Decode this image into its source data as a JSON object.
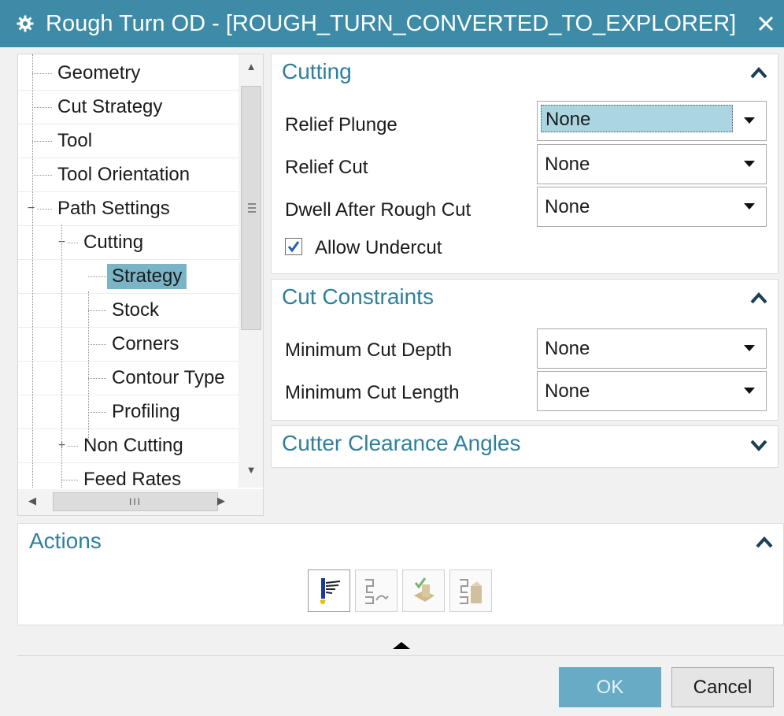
{
  "window": {
    "title": "Rough Turn OD - [ROUGH_TURN_CONVERTED_TO_EXPLORER]",
    "icon": "gear-icon",
    "close_icon": "close-icon"
  },
  "tree": {
    "items": [
      {
        "label": "Geometry",
        "level": 0
      },
      {
        "label": "Cut Strategy",
        "level": 0
      },
      {
        "label": "Tool",
        "level": 0
      },
      {
        "label": "Tool Orientation",
        "level": 0
      },
      {
        "label": "Path Settings",
        "level": 0,
        "expander": "−"
      },
      {
        "label": "Cutting",
        "level": 1,
        "expander": "−"
      },
      {
        "label": "Strategy",
        "level": 2,
        "selected": true
      },
      {
        "label": "Stock",
        "level": 2
      },
      {
        "label": "Corners",
        "level": 2
      },
      {
        "label": "Contour Type",
        "level": 2
      },
      {
        "label": "Profiling",
        "level": 2
      },
      {
        "label": "Non Cutting",
        "level": 1,
        "expander": "+"
      },
      {
        "label": "Feed Rates",
        "level": 1
      }
    ],
    "hscroll_grip": "III"
  },
  "cutting": {
    "header": "Cutting",
    "relief_plunge_label": "Relief Plunge",
    "relief_plunge_value": "None",
    "relief_cut_label": "Relief Cut",
    "relief_cut_value": "None",
    "dwell_label": "Dwell After Rough Cut",
    "dwell_value": "None",
    "allow_undercut_label": "Allow Undercut",
    "allow_undercut_checked": true
  },
  "cut_constraints": {
    "header": "Cut Constraints",
    "min_depth_label": "Minimum Cut Depth",
    "min_depth_value": "None",
    "min_length_label": "Minimum Cut Length",
    "min_length_value": "None"
  },
  "cutter_clearance": {
    "header": "Cutter Clearance Angles"
  },
  "actions": {
    "header": "Actions",
    "buttons": [
      "generate-icon",
      "replay-icon",
      "verify-icon",
      "list-icon"
    ]
  },
  "footer": {
    "ok_label": "OK",
    "cancel_label": "Cancel"
  },
  "colors": {
    "title_bar": "#3d8ba7",
    "accent": "#2f7f9c",
    "selection": "#79b4c7",
    "ok_button": "#67abc4"
  }
}
